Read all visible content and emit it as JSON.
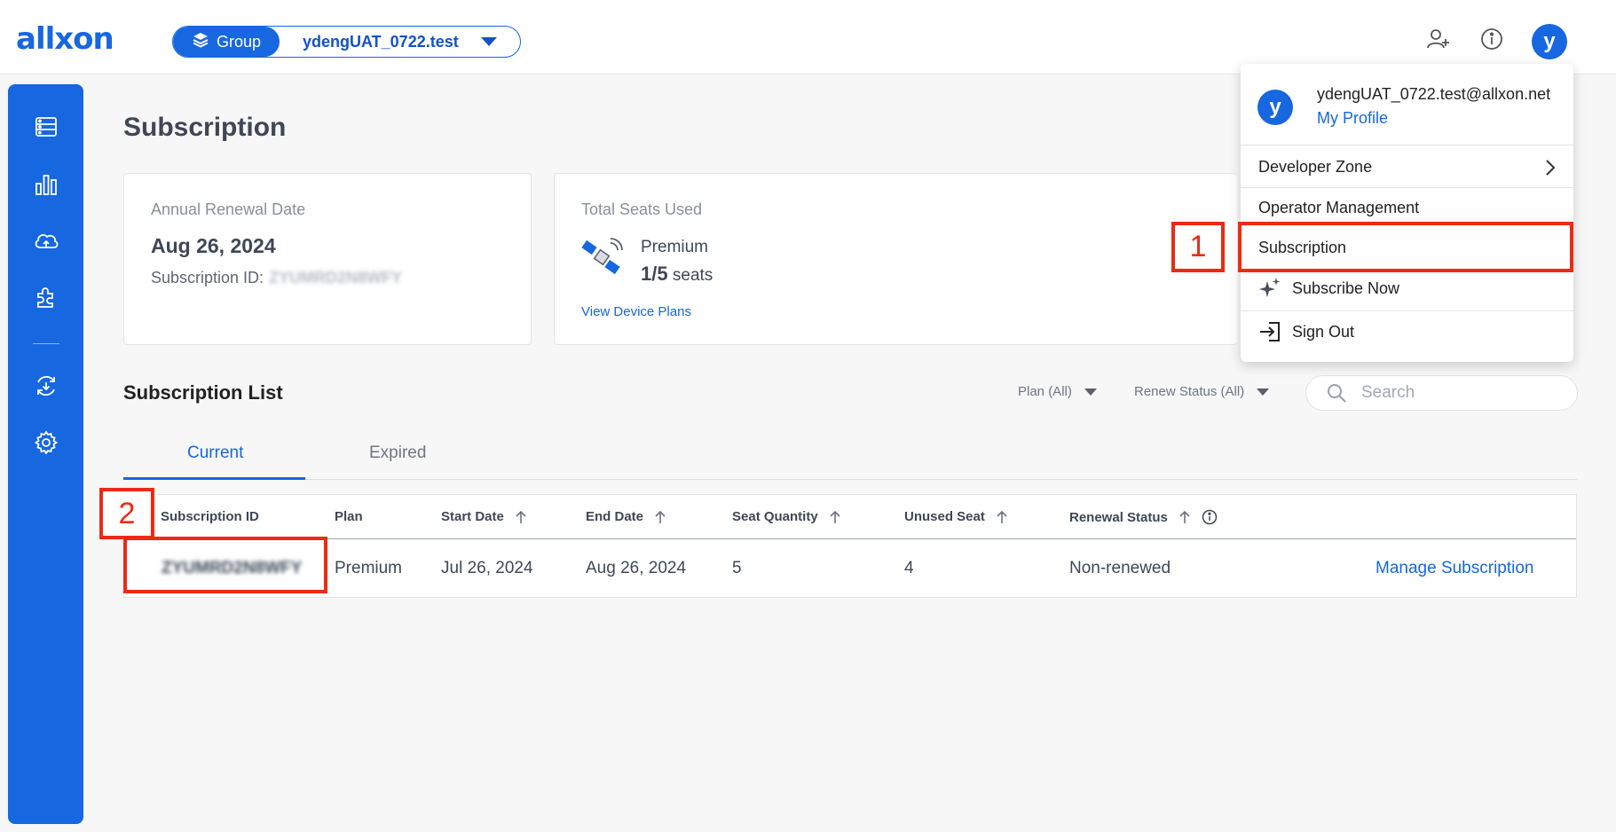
{
  "header": {
    "logo": "allxon",
    "group_label": "Group",
    "group_name": "ydengUAT_0722.test",
    "user_initial": "y",
    "add_user_icon": "user-plus-icon",
    "info_icon": "info-icon"
  },
  "sidebar": {
    "items": [
      {
        "icon": "devices-icon"
      },
      {
        "icon": "analytics-icon"
      },
      {
        "icon": "cloud-sync-icon"
      },
      {
        "icon": "plugin-icon"
      },
      {
        "icon": "ota-icon"
      },
      {
        "icon": "settings-icon"
      }
    ]
  },
  "page": {
    "title": "Subscription"
  },
  "renewal_card": {
    "label": "Annual Renewal Date",
    "date": "Aug 26, 2024",
    "subscription_id_label": "Subscription ID:",
    "subscription_id_value": "ZYUMRD2N8WFY"
  },
  "seats_card": {
    "label": "Total Seats Used",
    "plan": "Premium",
    "seats_used": "1/5",
    "seats_unit": "seats",
    "link": "View Device Plans"
  },
  "list": {
    "title": "Subscription List",
    "filter_plan": "Plan (All)",
    "filter_renew": "Renew Status (All)",
    "search_placeholder": "Search",
    "tabs": [
      "Current",
      "Expired"
    ],
    "columns": [
      "Subscription ID",
      "Plan",
      "Start Date",
      "End Date",
      "Seat Quantity",
      "Unused Seat",
      "Renewal Status"
    ],
    "rows": [
      {
        "subscription_id": "ZYUMRD2N8WFY",
        "plan": "Premium",
        "start_date": "Jul 26, 2024",
        "end_date": "Aug 26, 2024",
        "seat_quantity": "5",
        "unused_seat": "4",
        "renewal_status": "Non-renewed",
        "action": "Manage Subscription"
      }
    ]
  },
  "user_menu": {
    "initial": "y",
    "email": "ydengUAT_0722.test@allxon.net",
    "profile_link": "My Profile",
    "items": [
      "Developer Zone",
      "Operator Management",
      "Subscription",
      "Subscribe Now",
      "Sign Out"
    ]
  },
  "annotations": [
    "1",
    "2"
  ],
  "colors": {
    "brand": "#1667e0",
    "annotation": "#ee2a12"
  }
}
